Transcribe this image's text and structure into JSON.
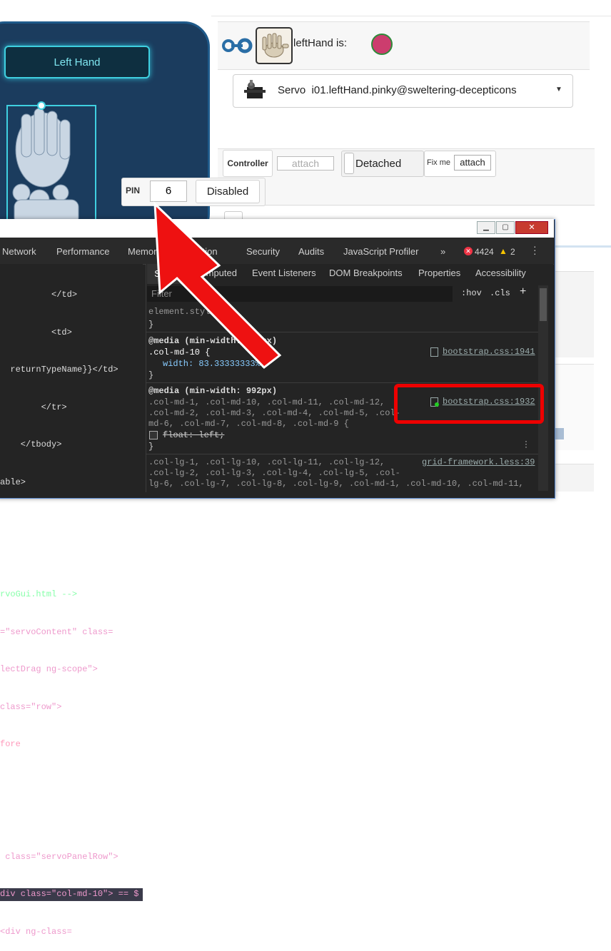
{
  "hand": {
    "title": "Left Hand"
  },
  "status": {
    "label": "leftHand is:"
  },
  "servo": {
    "type": "Servo",
    "name": "i01.leftHand.pinky@sweltering-decepticons"
  },
  "controller": {
    "label": "Controller",
    "attach_placeholder": "attach",
    "state": "Detached",
    "fix_label": "Fix me",
    "attach_button": "attach"
  },
  "pin": {
    "label": "PIN",
    "value": "6",
    "button": "Disabled"
  },
  "devtools": {
    "tabs": [
      "Network",
      "Performance",
      "Memory",
      "Application",
      "Security",
      "Audits",
      "JavaScript Profiler"
    ],
    "more": "»",
    "errors": "4424",
    "warnings": "2",
    "style_tabs": [
      "Styles",
      "Computed",
      "Event Listeners",
      "DOM Breakpoints",
      "Properties",
      "Accessibility"
    ],
    "filter_placeholder": "Filter",
    "hov": ":hov",
    "cls": ".cls",
    "plus": "+",
    "code_lines": [
      "          </td>",
      "          <td>",
      "  returnTypeName}}</td>",
      "        </tr>",
      "    </tbody>",
      "able>",
      "",
      "",
      "rvoGui.html -->",
      "=\"servoContent\" class=",
      "lectDrag ng-scope\">",
      "class=\"row\">",
      "fore",
      "",
      "",
      " class=\"servoPanelRow\">",
      "div class=\"col-md-10\"> == $",
      "<div ng-class="
    ],
    "rules": {
      "element_style": "element.style {",
      "close": "}",
      "media1": "@media (min-width: 992px)",
      "sel1": ".col-md-10 {",
      "prop1": "width: 83.33333333%;",
      "src1": "bootstrap.css:1941",
      "media2": "@media (min-width: 992px)",
      "sel2a": ".col-md-1, .col-md-10, .col-md-11, .col-md-12,",
      "sel2b": ".col-md-2, .col-md-3, .col-md-4, .col-md-5, .col-",
      "sel2c": "md-6, .col-md-7, .col-md-8, .col-md-9 {",
      "prop2": "float: left;",
      "src2": "bootstrap.css:1932",
      "src3": "grid-framework.less:39",
      "sel3a": ".col-lg-1, .col-lg-10, .col-lg-11, .col-lg-12,",
      "sel3b": ".col-lg-2, .col-lg-3, .col-lg-4, .col-lg-5, .col-",
      "sel3c": "lg-6, .col-lg-7, .col-lg-8, .col-lg-9, .col-md-1, .col-md-10, .col-md-11,"
    }
  },
  "colors": {
    "accent_red": "#ee1111",
    "status_dot": "#cc3d6e",
    "hand_bg": "#1b3c5e"
  }
}
